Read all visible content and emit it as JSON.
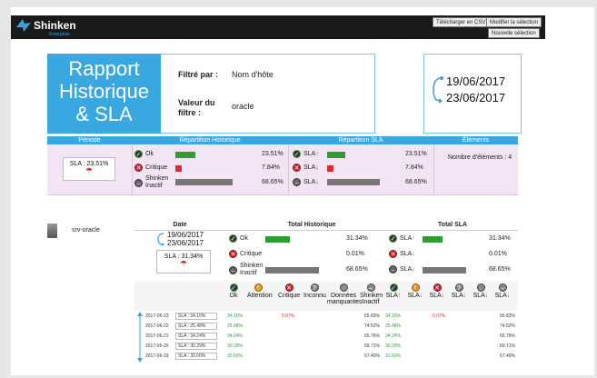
{
  "app": {
    "brand": "Shinken",
    "brand_sub": "Enterprise",
    "buttons": {
      "export_csv": "Télécharger en CSV",
      "modify_selection": "Modifier la sélection",
      "new_selection": "Nouvelle sélection"
    }
  },
  "report": {
    "title_lines": [
      "Rapport",
      "Historique",
      "& SLA"
    ],
    "filter_by_label": "Filtré par :",
    "filter_by_value": "Nom d'hôte",
    "filter_value_label_lines": [
      "Valeur du",
      "filtre :"
    ],
    "filter_value": "oracle",
    "date_start": "19/06/2017",
    "date_end": "23/06/2017"
  },
  "summary": {
    "headers": [
      "Période",
      "Répartition Historique",
      "Répartition SLA",
      "Éléments"
    ],
    "sla_label": "SLA : 23.51%",
    "historic": [
      {
        "label": "Ok",
        "pct": "23.51%",
        "value": 23.51,
        "color": "#2e9c2e"
      },
      {
        "label": "Critique",
        "pct": "7.84%",
        "value": 7.84,
        "color": "#d32f2f"
      },
      {
        "label_lines": [
          "Shinken",
          "Inactif"
        ],
        "pct": "68.65%",
        "value": 68.65,
        "color": "#777777"
      }
    ],
    "sla": [
      {
        "label": "SLA",
        "arrow": "↑",
        "pct": "23.51%",
        "value": 23.51,
        "color": "#2e9c2e"
      },
      {
        "label": "SLA",
        "arrow": "↓",
        "pct": "7.84%",
        "value": 7.84,
        "color": "#d32f2f"
      },
      {
        "label": "SLA",
        "arrow": "↓",
        "pct": "68.65%",
        "value": 68.65,
        "color": "#777777"
      }
    ],
    "elements_label": "Nombre d'éléments : 4"
  },
  "server": {
    "name": "srv-oracle",
    "headers": {
      "date": "Date",
      "historic": "Total Historique",
      "sla": "Total SLA"
    },
    "date_start": "19/06/2017",
    "date_end": "23/06/2017",
    "sla_label": "SLA : 31.34%",
    "historic": [
      {
        "label": "Ok",
        "pct": "31.34%",
        "value": 31.34
      },
      {
        "label": "Critique",
        "pct": "0.01%",
        "value": 0.01
      },
      {
        "label_lines": [
          "Shinken",
          "Inactif"
        ],
        "pct": "68.65%",
        "value": 68.65
      }
    ],
    "sla": [
      {
        "label": "SLA",
        "arrow": "↑",
        "pct": "31.34%",
        "value": 31.34
      },
      {
        "label": "SLA",
        "arrow": "↓",
        "pct": "0.01%",
        "value": 0.01
      },
      {
        "label": "SLA",
        "arrow": "↓",
        "pct": "68.65%",
        "value": 68.65
      }
    ],
    "columns": [
      {
        "label": "Ok",
        "icon": "ok"
      },
      {
        "label": "Attention",
        "icon": "warn"
      },
      {
        "label": "Critique",
        "icon": "crit"
      },
      {
        "label": "Inconnu",
        "icon": "unk"
      },
      {
        "label_lines": [
          "Données",
          "manquantes"
        ],
        "icon": "unk"
      },
      {
        "label_lines": [
          "Shinken",
          "Inactif"
        ],
        "icon": "unk"
      },
      {
        "label": "SLA",
        "arrow": "↑",
        "icon": "ok"
      },
      {
        "label": "SLA",
        "arrow": "↓",
        "icon": "warn"
      },
      {
        "label": "SLA",
        "arrow": "↓",
        "icon": "crit"
      },
      {
        "label": "SLA",
        "arrow": "↓",
        "icon": "unk"
      },
      {
        "label": "SLA",
        "arrow": "↓",
        "icon": "unk"
      },
      {
        "label": "SLA",
        "arrow": "↓",
        "icon": "unk"
      }
    ],
    "rows": [
      {
        "date": "2017-06-23",
        "sla": "SLA : 34.10%",
        "ok": "34.10%",
        "crit": "0.07%",
        "inactive": "65.83%",
        "sla_ok": "34.10%",
        "sla_crit": "0.07%",
        "sla_inactive": "65.83%"
      },
      {
        "date": "2017-06-22",
        "sla": "SLA : 25.48%",
        "ok": "25.48%",
        "crit": "",
        "inactive": "74.52%",
        "sla_ok": "25.48%",
        "sla_crit": "",
        "sla_inactive": "74.52%"
      },
      {
        "date": "2017-06-21",
        "sla": "SLA : 34.24%",
        "ok": "34.24%",
        "crit": "",
        "inactive": "65.76%",
        "sla_ok": "34.24%",
        "sla_crit": "",
        "sla_inactive": "65.76%"
      },
      {
        "date": "2017-06-20",
        "sla": "SLA : 30.29%",
        "ok": "30.29%",
        "crit": "",
        "inactive": "69.71%",
        "sla_ok": "30.29%",
        "sla_crit": "",
        "sla_inactive": "69.71%"
      },
      {
        "date": "2017-06-19",
        "sla": "SLA : 32.60%",
        "ok": "32.60%",
        "crit": "",
        "inactive": "67.40%",
        "sla_ok": "32.60%",
        "sla_crit": "",
        "sla_inactive": "67.40%"
      }
    ]
  }
}
